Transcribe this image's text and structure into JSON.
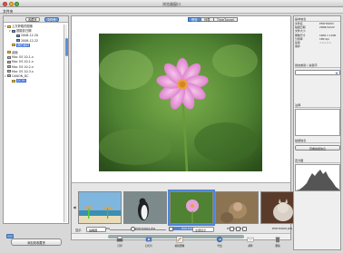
{
  "window": {
    "title": "浏览器窗口"
  },
  "menu": {
    "file_label": "文件夹"
  },
  "sidebar": {
    "tabs": [
      {
        "label": "收藏夹"
      },
      {
        "label": "文件夹"
      }
    ],
    "tree": [
      {
        "label": "上次获取的图像",
        "indent": 0,
        "icon": "folder-icon",
        "expanded": true
      },
      {
        "label": "按摄影日期",
        "indent": 1,
        "icon": "calendar-icon",
        "expanded": true
      },
      {
        "label": "2006-12-20",
        "indent": 2,
        "icon": "calendar-icon"
      },
      {
        "label": "2006-12-22",
        "indent": 2,
        "icon": "calendar-icon"
      },
      {
        "label": "我的素材",
        "indent": 1,
        "icon": "folder-icon",
        "selected": true
      },
      {
        "label": "",
        "indent": 0,
        "icon": ""
      },
      {
        "label": "桌面",
        "indent": 0,
        "icon": "folder-icon"
      },
      {
        "label": "Mac OS 10.1.x",
        "indent": 0,
        "icon": "disk-icon"
      },
      {
        "label": "Mac OS 10.1.x",
        "indent": 0,
        "icon": "disk-icon"
      },
      {
        "label": "Mac OS 10.2.x",
        "indent": 0,
        "icon": "disk-icon"
      },
      {
        "label": "Mac OS 10.3.x",
        "indent": 0,
        "icon": "disk-icon"
      },
      {
        "label": "CANON_DC",
        "indent": 0,
        "icon": "disk-icon",
        "expanded": true
      },
      {
        "label": "DCIM",
        "indent": 1,
        "icon": "folder-icon",
        "selected": true
      }
    ]
  },
  "add_button_label": "添加到收藏夹",
  "view_tabs": [
    {
      "label": "预览",
      "active": true
    },
    {
      "label": "列表"
    },
    {
      "label": "TimeTunnel"
    }
  ],
  "filmstrip": {
    "thumbs": [
      {
        "label": "PHOTO001.JPG"
      },
      {
        "label": "PHOTO002.JPG"
      },
      {
        "label": "PHOTO003.JPG",
        "selected": true
      },
      {
        "label": "PHOTO004.JPG"
      },
      {
        "label": "PHOTO005.JPG"
      },
      {
        "label": "PHOTO006.JPG"
      }
    ]
  },
  "controls": {
    "sort_label": "显示",
    "sort_value": "缩略图",
    "filter_value": "全部显示"
  },
  "tools": [
    {
      "label": "打印",
      "icon": "print-icon"
    },
    {
      "label": "幻灯片",
      "icon": "slideshow-icon"
    },
    {
      "label": "编辑图像",
      "icon": "edit-icon"
    },
    {
      "label": "导出",
      "icon": "export-icon"
    },
    {
      "label": "邮件",
      "icon": "mail-icon"
    },
    {
      "label": "删除",
      "icon": "trash-icon"
    }
  ],
  "info": {
    "header": "基本信息",
    "rows": [
      {
        "k": "文件名",
        "v": "PHOTO003"
      },
      {
        "k": "拍摄日期",
        "v": "2006/12/22"
      },
      {
        "k": "文件大小",
        "v": ""
      },
      {
        "k": "图像尺寸",
        "v": "1600 x 1200"
      },
      {
        "k": "分辨率",
        "v": "180 dpi"
      },
      {
        "k": "星级",
        "v": "☆☆☆☆☆"
      },
      {
        "k": "保护",
        "v": ""
      }
    ]
  },
  "rightpanel": {
    "classify_header": "我的类别 / 关键字",
    "classify_dd": "",
    "comment_header": "注释",
    "shot_header": "拍摄信息",
    "shot_button": "查看拍摄信息",
    "histogram_header": "直方图"
  },
  "colors": {
    "selection": "#3d6fd6",
    "accent": "#5b8fd8"
  }
}
